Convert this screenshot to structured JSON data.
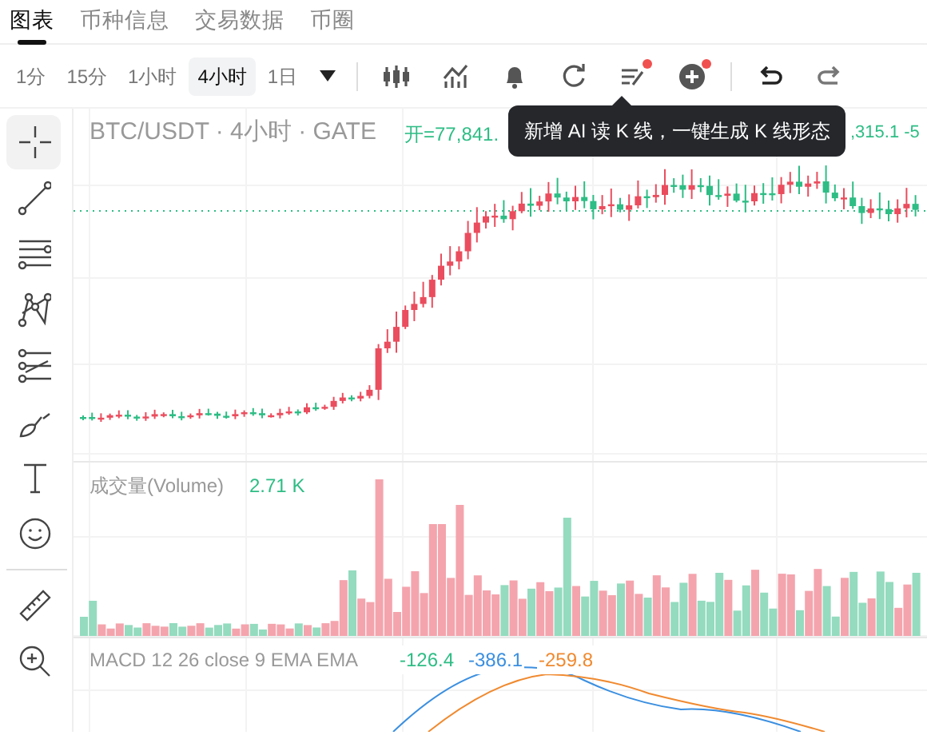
{
  "tabs": [
    {
      "label": "图表",
      "selected": true
    },
    {
      "label": "币种信息",
      "selected": false
    },
    {
      "label": "交易数据",
      "selected": false
    },
    {
      "label": "币圈",
      "selected": false
    }
  ],
  "intervals": [
    {
      "label": "1分",
      "selected": false
    },
    {
      "label": "15分",
      "selected": false
    },
    {
      "label": "1小时",
      "selected": false
    },
    {
      "label": "4小时",
      "selected": true
    },
    {
      "label": "1日",
      "selected": false
    }
  ],
  "toolbar": [
    {
      "kind": "candles",
      "badge": false
    },
    {
      "kind": "indicator",
      "badge": false
    },
    {
      "kind": "alert",
      "badge": false
    },
    {
      "kind": "refresh",
      "badge": false
    },
    {
      "kind": "notes",
      "badge": true
    },
    {
      "kind": "add",
      "badge": true
    },
    {
      "kind": "undo",
      "badge": false
    },
    {
      "kind": "redo",
      "badge": false
    }
  ],
  "tools": [
    {
      "kind": "crosshair",
      "selected": true
    },
    {
      "kind": "line",
      "selected": false
    },
    {
      "kind": "hlines",
      "selected": false
    },
    {
      "kind": "pattern",
      "selected": false
    },
    {
      "kind": "fib",
      "selected": false
    },
    {
      "kind": "brush",
      "selected": false
    },
    {
      "kind": "text",
      "selected": false
    },
    {
      "kind": "emoji",
      "selected": false
    },
    {
      "kind": "ruler",
      "selected": false
    },
    {
      "kind": "zoom",
      "selected": false
    }
  ],
  "chart": {
    "title": "BTC/USDT · 4小时 · GATE",
    "open_label": "开=77,841.",
    "right_values": ",315.1 -5"
  },
  "tooltip": "新增 AI 读 K 线，一键生成 K 线形态",
  "volume": {
    "label": "成交量(Volume)",
    "value": "2.71 K"
  },
  "macd": {
    "label": "MACD 12 26 close 9 EMA EMA",
    "values": [
      {
        "text": "-126.4",
        "color": "#2ebd85"
      },
      {
        "text": "-386.1",
        "color": "#3b8fe0"
      },
      {
        "text": "-259.8",
        "color": "#f08a30"
      }
    ]
  }
}
